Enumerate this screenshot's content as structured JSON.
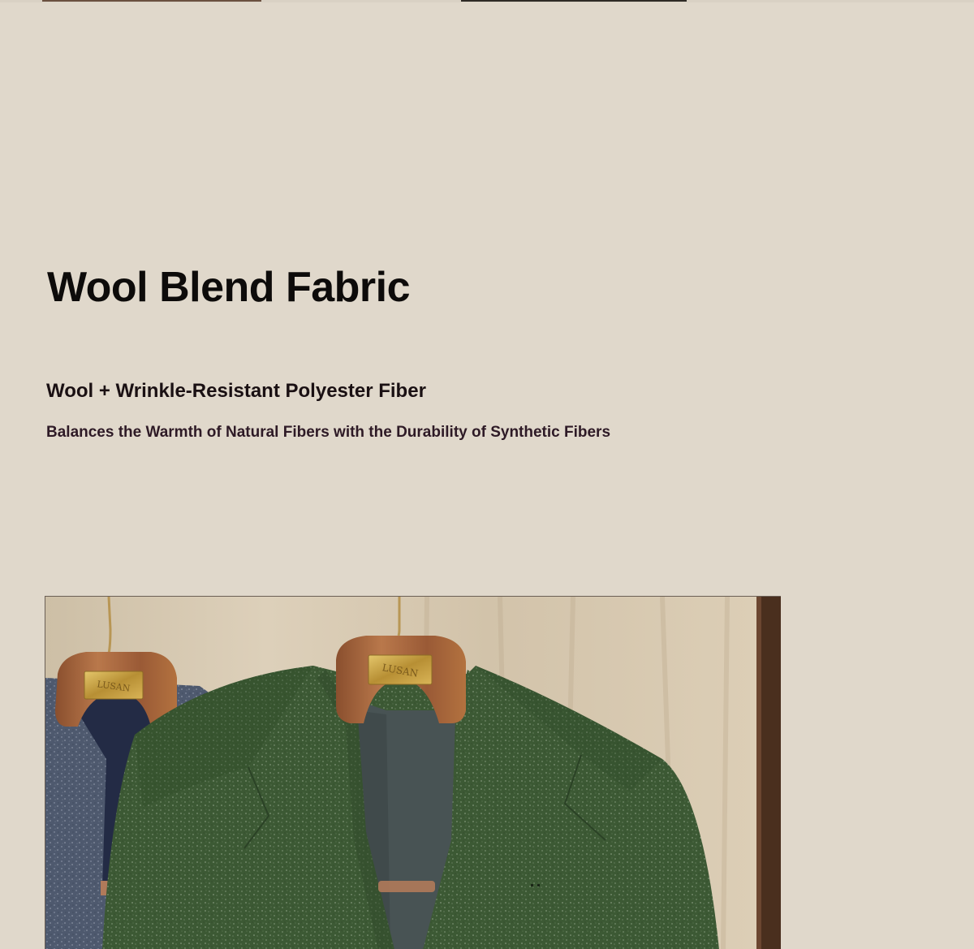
{
  "product_section": {
    "title": "Wool Blend Fabric",
    "subtitle": "Wool + Wrinkle-Resistant Polyester Fiber",
    "description": "Balances the Warmth of Natural Fibers with the Durability of Synthetic Fibers"
  },
  "product_image": {
    "hanger_brand": "LUSAN",
    "palette": {
      "background": "#e0d8cb",
      "curtain": "#d8c7ae",
      "green_jacket": "#3d5a35",
      "grey_jacket": "#4f5a70",
      "lining_navy": "#232b45",
      "lining_grey": "#4a5354",
      "hanger_wood": "#a86a42",
      "brass_plate": "#c9a64a"
    }
  }
}
